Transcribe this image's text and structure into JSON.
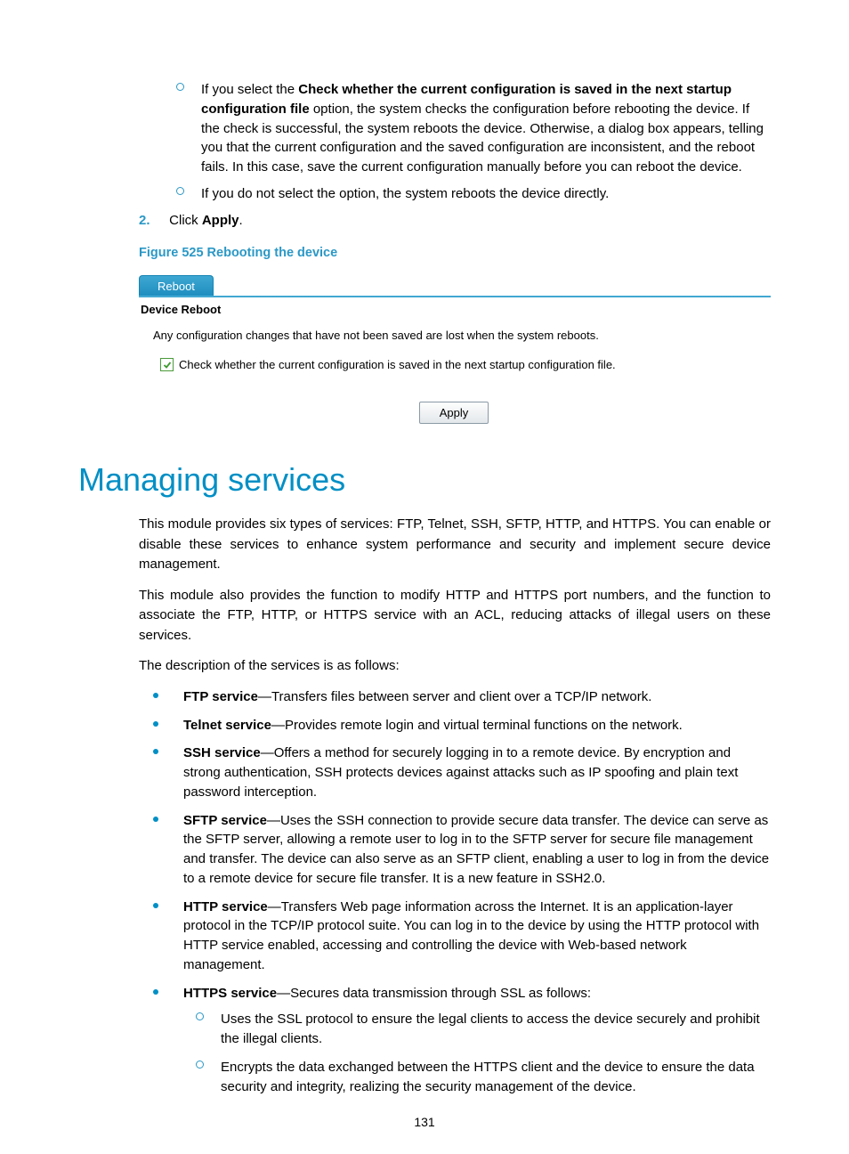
{
  "top_sub_items": [
    {
      "prefix": "If you select the ",
      "bold": "Check whether the current configuration is saved in the next startup configuration file",
      "suffix": " option, the system checks the configuration before rebooting the device. If the check is successful, the system reboots the device. Otherwise, a dialog box appears, telling you that the current configuration and the saved configuration are inconsistent, and the reboot fails. In this case, save the current configuration manually before you can reboot the device."
    },
    {
      "prefix": "If you do not select the option, the system reboots the device directly.",
      "bold": "",
      "suffix": ""
    }
  ],
  "step2": {
    "num": "2.",
    "prefix": "Click ",
    "bold": "Apply",
    "suffix": "."
  },
  "figure_caption": "Figure 525 Rebooting the device",
  "figure": {
    "tab": "Reboot",
    "title": "Device Reboot",
    "warning": "Any configuration changes that have not been saved are lost when the system reboots.",
    "checkbox_label": "Check whether the current configuration is saved in the next startup configuration file.",
    "apply": "Apply"
  },
  "heading": "Managing services",
  "para1": "This module provides six types of services: FTP, Telnet, SSH, SFTP, HTTP, and HTTPS. You can enable or disable these services to enhance system performance and security and implement secure device management.",
  "para2": "This module also provides the function to modify HTTP and HTTPS port numbers, and the function to associate the FTP, HTTP, or HTTPS service with an ACL, reducing attacks of illegal users on these services.",
  "para3": "The description of the services is as follows:",
  "services": [
    {
      "name": "FTP service",
      "desc": "—Transfers files between server and client over a TCP/IP network."
    },
    {
      "name": "Telnet service",
      "desc": "—Provides remote login and virtual terminal functions on the network."
    },
    {
      "name": "SSH service",
      "desc": "—Offers a method for securely logging in to a remote device. By encryption and strong authentication, SSH protects devices against attacks such as IP spoofing and plain text password interception."
    },
    {
      "name": "SFTP service",
      "desc": "—Uses the SSH connection to provide secure data transfer. The device can serve as the SFTP server, allowing a remote user to log in to the SFTP server for secure file management and transfer. The device can also serve as an SFTP client, enabling a user to log in from the device to a remote device for secure file transfer. It is a new feature in SSH2.0."
    },
    {
      "name": "HTTP service",
      "desc": "—Transfers Web page information across the Internet. It is an application-layer protocol in the TCP/IP protocol suite. You can log in to the device by using the HTTP protocol with HTTP service enabled, accessing and controlling the device with Web-based network management."
    },
    {
      "name": "HTTPS service",
      "desc": "—Secures data transmission through SSL as follows:"
    }
  ],
  "https_sub": [
    "Uses the SSL protocol to ensure the legal clients to access the device securely and prohibit the illegal clients.",
    "Encrypts the data exchanged between the HTTPS client and the device to ensure the data security and integrity, realizing the security management of the device."
  ],
  "page_number": "131"
}
